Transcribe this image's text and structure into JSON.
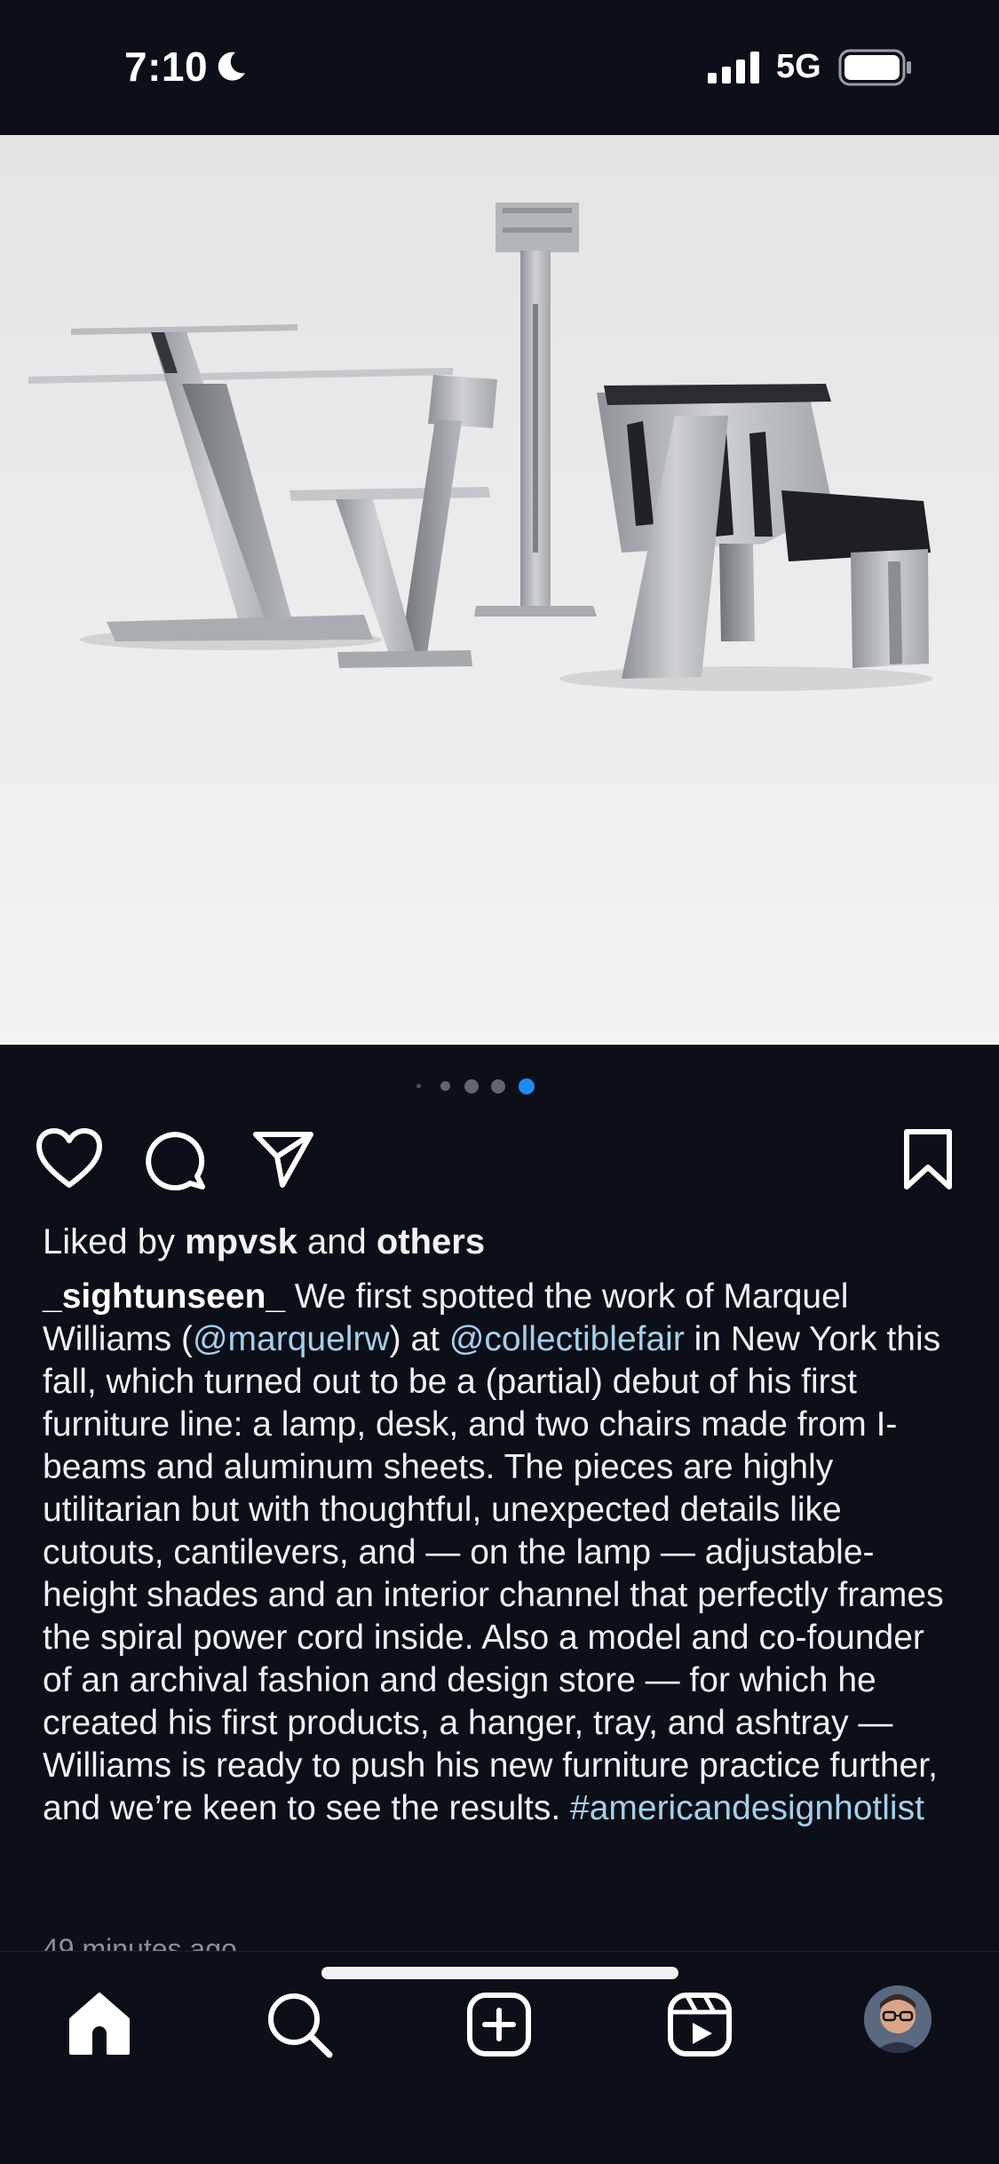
{
  "status_bar": {
    "time": "7:10",
    "network": "5G"
  },
  "post": {
    "carousel": {
      "count": 5,
      "active_index": 4
    },
    "likes": {
      "prefix": "Liked by",
      "user": "mpvsk",
      "middle": "and",
      "suffix": "others"
    },
    "caption": {
      "username": "_sightunseen_",
      "text_1": " We first spotted the work of Marquel Williams (",
      "mention_1": "@marquelrw",
      "text_2": ") at ",
      "mention_2": "@collectiblefair",
      "text_3": " in New York this fall, which turned out to be a (partial) debut of his first furniture line: a lamp, desk, and two chairs made from I-beams and aluminum sheets. The pieces are highly utilitarian but with thoughtful, unexpected details like cutouts, cantilevers, and — on the lamp — adjustable-height shades and an interior channel that perfectly frames the spiral power cord inside. Also a model and co-founder of an archival fashion and design store — for which he created his first products, a hanger, tray, and ashtray — Williams is ready to push his new furniture practice further, and we’re keen to see the results. ",
      "hashtag": "#americandesignhotlist"
    },
    "timestamp": "49 minutes ago"
  },
  "icons": {
    "actions": [
      "heart-icon",
      "comment-icon",
      "share-icon",
      "bookmark-icon"
    ],
    "nav": [
      "home-icon",
      "search-icon",
      "create-icon",
      "reels-icon",
      "profile-avatar"
    ]
  },
  "colors": {
    "background": "#0c0f17",
    "accent_blue": "#1d8cf8",
    "link": "#a5cfea"
  }
}
